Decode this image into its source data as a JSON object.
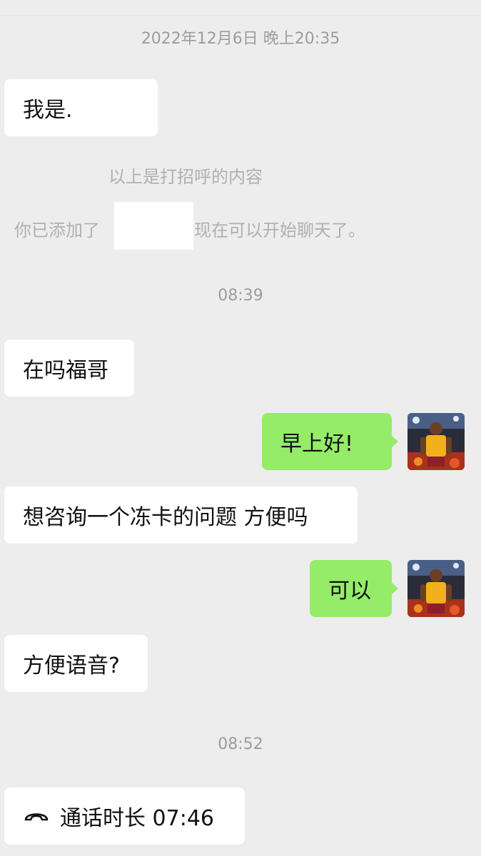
{
  "timestamps": {
    "first": "2022年12月6日 晚上20:35",
    "second": "08:39",
    "third": "08:52"
  },
  "system": {
    "greeting_note": "以上是打招呼的内容",
    "added_prefix": "你已添加了",
    "added_suffix": "现在可以开始聊天了。"
  },
  "messages": [
    {
      "side": "in",
      "text": "我是."
    },
    {
      "side": "in",
      "text": "在吗福哥"
    },
    {
      "side": "out",
      "text": "早上好!"
    },
    {
      "side": "in",
      "text": "想咨询一个冻卡的问题 方便吗"
    },
    {
      "side": "out",
      "text": "可以"
    },
    {
      "side": "in",
      "text": "方便语音?"
    }
  ],
  "call": {
    "icon": "phone-hangup-icon",
    "text": "通话时长 07:46"
  },
  "colors": {
    "background": "#ededed",
    "incoming_bubble": "#ffffff",
    "outgoing_bubble": "#95ec69",
    "timestamp_text": "#9c9c9c"
  }
}
